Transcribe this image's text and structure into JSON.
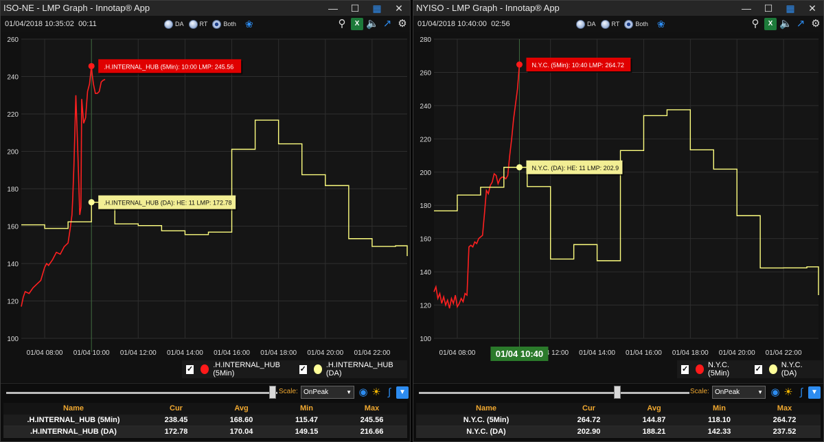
{
  "panels": [
    {
      "title": "ISO-NE - LMP Graph - Innotap® App",
      "timestamp": "01/04/2018 10:35:02",
      "elapsed": "00:11",
      "radio_options": [
        "DA",
        "RT",
        "Both"
      ],
      "selected_mode": "Both",
      "scale_label": "Scale:",
      "scale_value": "OnPeak",
      "tooltips": [
        {
          "text": ".H.INTERNAL_HUB (5Min): 10:00 LMP: 245.56",
          "style": "red"
        },
        {
          "text": ".H.INTERNAL_HUB (DA): HE: 11 LMP: 172.78",
          "style": "yellow"
        }
      ],
      "legend": [
        {
          "label": ".H.INTERNAL_HUB (5Min)",
          "color": "#ff0000",
          "checked": true
        },
        {
          "label": ".H.INTERNAL_HUB (DA)",
          "color": "#ffff80",
          "checked": true
        }
      ],
      "table": {
        "headers": [
          "Name",
          "Cur",
          "Avg",
          "Min",
          "Max"
        ],
        "rows": [
          [
            ".H.INTERNAL_HUB (5Min)",
            "238.45",
            "168.60",
            "115.47",
            "245.56"
          ],
          [
            ".H.INTERNAL_HUB (DA)",
            "172.78",
            "170.04",
            "149.15",
            "216.66"
          ]
        ]
      },
      "chart_data": {
        "type": "line",
        "ylim": [
          100,
          260
        ],
        "yticks": [
          "100",
          "120",
          "140",
          "160",
          "180",
          "200",
          "220",
          "240",
          "260"
        ],
        "xlim": [
          "07:00",
          "23:30"
        ],
        "xticks": [
          "01/04 08:00",
          "01/04 10:00",
          "01/04 12:00",
          "01/04 14:00",
          "01/04 16:00",
          "01/04 18:00",
          "01/04 20:00",
          "01/04 22:00"
        ],
        "cursor_x": "10:00",
        "series": [
          {
            "name": ".H.INTERNAL_HUB (5Min)",
            "color": "#ff2020",
            "x": [
              "07:00",
              "07:05",
              "07:10",
              "07:20",
              "07:30",
              "07:40",
              "07:50",
              "08:00",
              "08:05",
              "08:10",
              "08:20",
              "08:30",
              "08:40",
              "08:50",
              "09:00",
              "09:05",
              "09:10",
              "09:12",
              "09:15",
              "09:20",
              "09:25",
              "09:30",
              "09:33",
              "09:35",
              "09:40",
              "09:45",
              "09:50",
              "09:55",
              "10:00",
              "10:02",
              "10:05",
              "10:10",
              "10:15",
              "10:20",
              "10:25",
              "10:30",
              "10:35"
            ],
            "values": [
              117,
              122,
              125,
              124,
              127,
              129,
              131,
              138,
              140,
              139,
              142,
              146,
              145,
              149,
              151,
              158,
              166,
              175,
              192,
              230,
              200,
              166,
              170,
              228,
              215,
              218,
              232,
              236,
              245.56,
              241,
              236,
              231,
              231,
              232,
              237,
              238,
              238.45
            ]
          },
          {
            "name": ".H.INTERNAL_HUB (DA)",
            "color": "#ffff80",
            "step": true,
            "x": [
              "07:00",
              "08:00",
              "09:00",
              "10:00",
              "11:00",
              "12:00",
              "13:00",
              "14:00",
              "15:00",
              "16:00",
              "17:00",
              "18:00",
              "19:00",
              "20:00",
              "21:00",
              "22:00",
              "23:00",
              "23:30"
            ],
            "values": [
              160.7,
              158.8,
              162.3,
              172.78,
              161.2,
              160.3,
              157.5,
              155.5,
              156.8,
              201.1,
              216.66,
              204.0,
              187.5,
              181.7,
              153.3,
              149.15,
              149.5,
              144
            ]
          }
        ]
      }
    },
    {
      "title": "NYISO - LMP Graph - Innotap® App",
      "timestamp": "01/04/2018 10:40:00",
      "elapsed": "02:56",
      "radio_options": [
        "DA",
        "RT",
        "Both"
      ],
      "selected_mode": "Both",
      "scale_label": "Scale:",
      "scale_value": "OnPeak",
      "cursor_label": "01/04 10:40",
      "tooltips": [
        {
          "text": "N.Y.C. (5Min): 10:40 LMP: 264.72",
          "style": "red"
        },
        {
          "text": "N.Y.C. (DA): HE: 11 LMP: 202.9",
          "style": "yellow"
        }
      ],
      "legend": [
        {
          "label": "N.Y.C. (5Min)",
          "color": "#ff0000",
          "checked": true
        },
        {
          "label": "N.Y.C. (DA)",
          "color": "#ffff80",
          "checked": true
        }
      ],
      "table": {
        "headers": [
          "Name",
          "Cur",
          "Avg",
          "Min",
          "Max"
        ],
        "rows": [
          [
            "N.Y.C. (5Min)",
            "264.72",
            "144.87",
            "118.10",
            "264.72"
          ],
          [
            "N.Y.C. (DA)",
            "202.90",
            "188.21",
            "142.33",
            "237.52"
          ]
        ]
      },
      "chart_data": {
        "type": "line",
        "ylim": [
          100,
          280
        ],
        "yticks": [
          "100",
          "120",
          "140",
          "160",
          "180",
          "200",
          "220",
          "240",
          "260",
          "280"
        ],
        "xlim": [
          "07:00",
          "23:30"
        ],
        "xticks": [
          "01/04 08:00",
          "01/04 12:00",
          "01/04 14:00",
          "01/04 16:00",
          "01/04 18:00",
          "01/04 20:00",
          "01/04 22:00"
        ],
        "cursor_x": "10:40",
        "series": [
          {
            "name": "N.Y.C. (5Min)",
            "color": "#ff2020",
            "x": [
              "07:00",
              "07:05",
              "07:10",
              "07:15",
              "07:20",
              "07:25",
              "07:30",
              "07:35",
              "07:40",
              "07:45",
              "07:50",
              "07:55",
              "08:00",
              "08:05",
              "08:10",
              "08:15",
              "08:20",
              "08:25",
              "08:30",
              "08:35",
              "08:40",
              "08:45",
              "08:50",
              "08:55",
              "09:00",
              "09:05",
              "09:10",
              "09:15",
              "09:20",
              "09:25",
              "09:30",
              "09:35",
              "09:40",
              "09:45",
              "09:50",
              "09:55",
              "10:00",
              "10:05",
              "10:10",
              "10:15",
              "10:20",
              "10:25",
              "10:30",
              "10:35",
              "10:40"
            ],
            "values": [
              128,
              131,
              124,
              127,
              121,
              125,
              120,
              123,
              118.1,
              124,
              121,
              126,
              119,
              121,
              124,
              122,
              127,
              126,
              155,
              156,
              155,
              158,
              157,
              160,
              161,
              162,
              175,
              189,
              187,
              192,
              194,
              199,
              198,
              193,
              196,
              197,
              197,
              196,
              198,
              210,
              220,
              232,
              241,
              250,
              264.72
            ]
          },
          {
            "name": "N.Y.C. (DA)",
            "color": "#ffff80",
            "step": true,
            "x": [
              "07:00",
              "08:00",
              "09:00",
              "10:00",
              "11:00",
              "12:00",
              "13:00",
              "14:00",
              "15:00",
              "16:00",
              "17:00",
              "18:00",
              "19:00",
              "20:00",
              "21:00",
              "22:00",
              "23:00",
              "23:30"
            ],
            "values": [
              176.7,
              186.2,
              190.9,
              202.9,
              191.3,
              147.7,
              156.4,
              146.7,
              213.0,
              234.0,
              237.52,
              213.4,
              201.8,
              173.8,
              142.33,
              142.4,
              143,
              126
            ]
          }
        ]
      }
    }
  ]
}
